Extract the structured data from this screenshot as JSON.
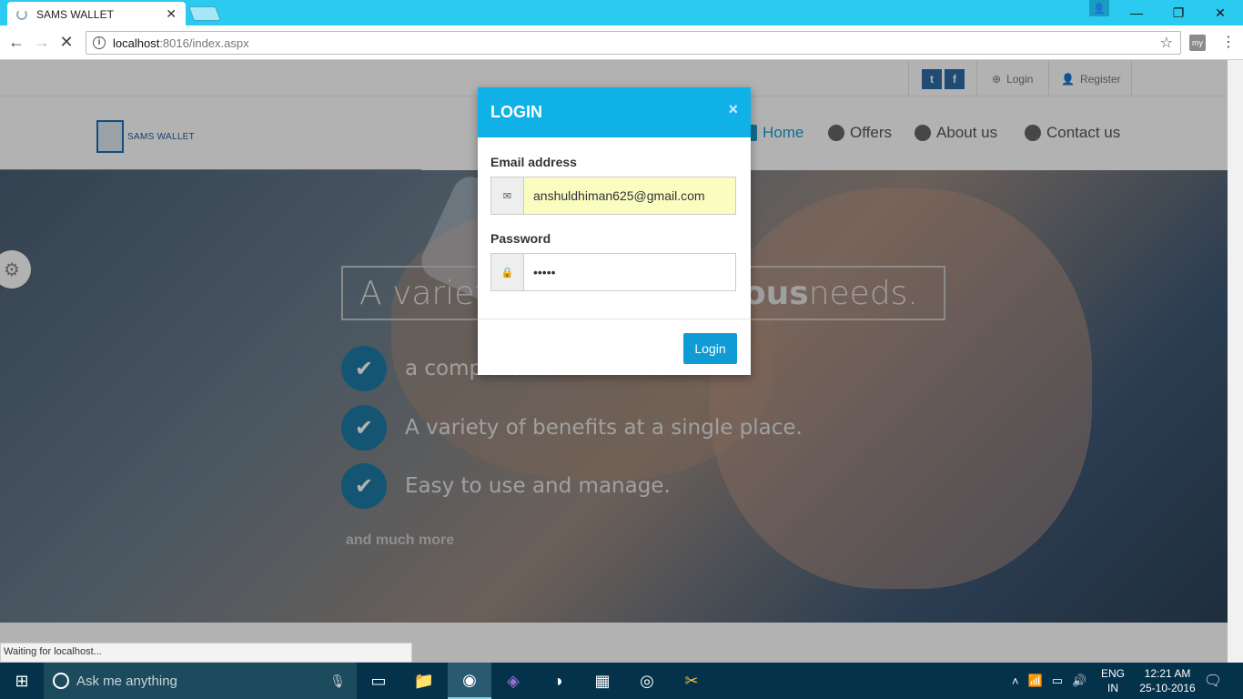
{
  "browser": {
    "tab_title": "SAMS WALLET",
    "url_host": "localhost",
    "url_path": ":8016/index.aspx",
    "info_icon": "i",
    "ext_label": "my"
  },
  "top_links": {
    "login": "Login",
    "register": "Register",
    "twitter_icon": "t",
    "facebook_icon": "f"
  },
  "logo_text": "SAMS WALLET",
  "nav": {
    "home": "Home",
    "offers": "Offers",
    "about": "About us",
    "contact": "Contact us"
  },
  "hero": {
    "headline_pre": "A variety",
    "headline_bold": "rious",
    "headline_post": " needs.",
    "features": [
      "a complete solutions to all",
      "A variety of benefits at a single place.",
      "Easy to use and manage."
    ],
    "more": "and much more"
  },
  "modal": {
    "title": "LOGIN",
    "close_glyph": "×",
    "email_label": "Email address",
    "email_value": "anshuldhiman625@gmail.com",
    "password_label": "Password",
    "password_value": "•••••",
    "submit_label": "Login",
    "header_color": "#0fb1e6"
  },
  "status_text": "Waiting for localhost...",
  "taskbar": {
    "search_placeholder": "Ask me anything",
    "lang_top": "ENG",
    "lang_bottom": "IN",
    "time": "12:21 AM",
    "date": "25-10-2016"
  }
}
